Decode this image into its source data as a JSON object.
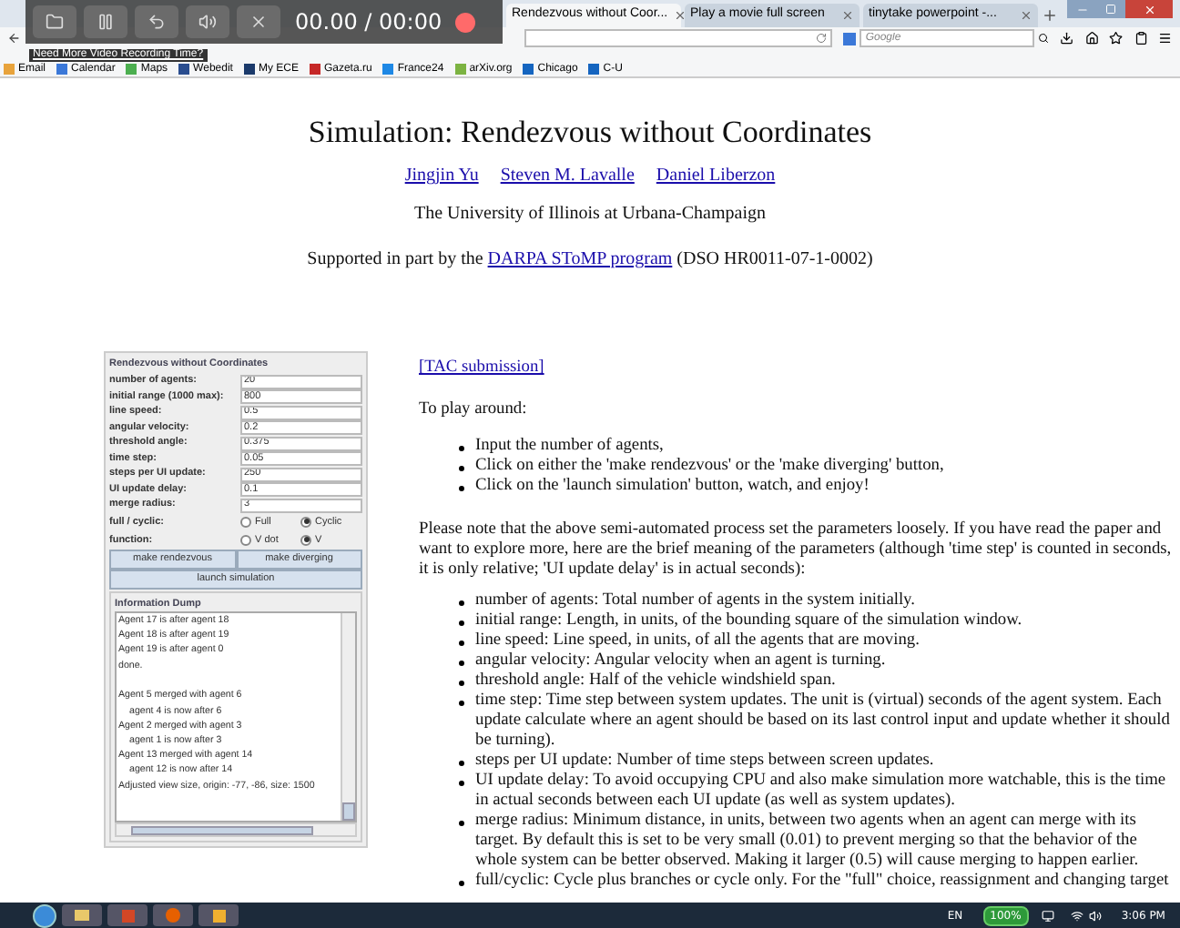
{
  "recorder": {
    "time": "00.00 / 00:00",
    "promo_link": "Need More Video Recording Time?"
  },
  "tabs": [
    {
      "label": "Rendezvous without Coor...",
      "selected": true
    },
    {
      "label": "Play a movie full screen",
      "selected": false
    },
    {
      "label": "tinytake powerpoint -...",
      "selected": false
    }
  ],
  "search": {
    "placeholder": "Google"
  },
  "bookmarks": [
    {
      "label": "Email",
      "color": "#e8a33c"
    },
    {
      "label": "Calendar",
      "color": "#3b78d8"
    },
    {
      "label": "Maps",
      "color": "#4caf50"
    },
    {
      "label": "Webedit",
      "color": "#2a4d8f"
    },
    {
      "label": "My ECE",
      "color": "#1b3a6b"
    },
    {
      "label": "Gazeta.ru",
      "color": "#c62828"
    },
    {
      "label": "France24",
      "color": "#1e88e5"
    },
    {
      "label": "arXiv.org",
      "color": "#7cb342"
    },
    {
      "label": "Chicago",
      "color": "#1565c0"
    },
    {
      "label": "C-U",
      "color": "#1565c0"
    }
  ],
  "page": {
    "title": "Simulation: Rendezvous without Coordinates",
    "authors": [
      "Jingjin Yu",
      "Steven M. Lavalle",
      "Daniel Liberzon"
    ],
    "affiliation": "The University of Illinois at Urbana-Champaign",
    "support": {
      "before": "Supported in part by the",
      "link": "DARPA SToMP program",
      "after": "(DSO HR0011-07-1-0002)"
    },
    "submission_link": "[TAC submission]",
    "intro": "To play around:",
    "steps": [
      "Input the number of agents,",
      "Click on either the 'make rendezvous' or the 'make diverging' button,",
      "Click on the 'launch simulation' button, watch, and enjoy!"
    ],
    "note": "Please note that the above semi-automated process set the parameters loosely. If you have read the paper and want to explore more, here are the brief meaning of the parameters (although 'time step' is counted in seconds, it is only relative; 'UI update delay' is in actual seconds):",
    "params": [
      "number of agents: Total number of agents in the system initially.",
      "initial range: Length, in units, of the bounding square of the simulation window.",
      "line speed: Line speed, in units, of all the agents that are moving.",
      "angular velocity: Angular velocity when an agent is turning.",
      "threshold angle: Half of the vehicle windshield span.",
      "time step: Time step between system updates. The unit is (virtual) seconds of the agent system. Each update calculate where an agent should be based on its last control input and update whether it should be turning).",
      "steps per UI update: Number of time steps between screen updates.",
      "UI update delay: To avoid occupying CPU and also make simulation more watchable, this is the time in actual seconds between each UI update (as well as system updates).",
      "merge radius: Minimum distance, in units, between two agents when an agent can merge with its target. By default this is set to be very small (0.01) to prevent merging so that the behavior of the whole system can be better observed. Making it larger (0.5) will cause merging to happen earlier.",
      "full/cyclic: Cycle plus branches or cycle only. For the \"full\" choice, reassignment and changing target"
    ]
  },
  "applet": {
    "title": "Rendezvous without Coordinates",
    "fields": [
      {
        "label": "number of agents:",
        "value": "20"
      },
      {
        "label": "initial range (1000 max):",
        "value": "800"
      },
      {
        "label": "line speed:",
        "value": "0.5"
      },
      {
        "label": "angular velocity:",
        "value": "0.2"
      },
      {
        "label": "threshold angle:",
        "value": "0.375"
      },
      {
        "label": "time step:",
        "value": "0.05"
      },
      {
        "label": "steps per UI update:",
        "value": "250"
      },
      {
        "label": "UI update delay:",
        "value": "0.1"
      },
      {
        "label": "merge radius:",
        "value": "3"
      }
    ],
    "radio_groups": [
      {
        "label": "full / cyclic:",
        "options": [
          {
            "label": "Full",
            "selected": false
          },
          {
            "label": "Cyclic",
            "selected": true
          }
        ]
      },
      {
        "label": "function:",
        "options": [
          {
            "label": "V dot",
            "selected": false
          },
          {
            "label": "V",
            "selected": true
          }
        ]
      }
    ],
    "buttons": [
      "make rendezvous",
      "make diverging"
    ],
    "launch_button": "launch simulation",
    "dump_title": "Information Dump",
    "dump_lines": [
      {
        "text": "Agent 17 is after agent 18",
        "kind": "main"
      },
      {
        "text": "Agent 18 is after agent 19",
        "kind": "main"
      },
      {
        "text": "Agent 19 is after agent 0",
        "kind": "main"
      },
      {
        "text": "done.",
        "kind": "main"
      },
      {
        "text": "Agent 5 merged with agent 6",
        "kind": "gap"
      },
      {
        "text": "agent 4 is now after 6",
        "kind": "sub"
      },
      {
        "text": "Agent 2 merged with agent 3",
        "kind": "main"
      },
      {
        "text": "agent 1 is now after 3",
        "kind": "sub"
      },
      {
        "text": "Agent 13 merged with agent 14",
        "kind": "main"
      },
      {
        "text": "agent 12 is now after 14",
        "kind": "sub"
      },
      {
        "text": "Adjusted view size, origin: -77, -86, size: 1500",
        "kind": "main"
      }
    ]
  },
  "taskbar": {
    "language": "EN",
    "battery": "100%",
    "clock": "3:06 PM"
  }
}
